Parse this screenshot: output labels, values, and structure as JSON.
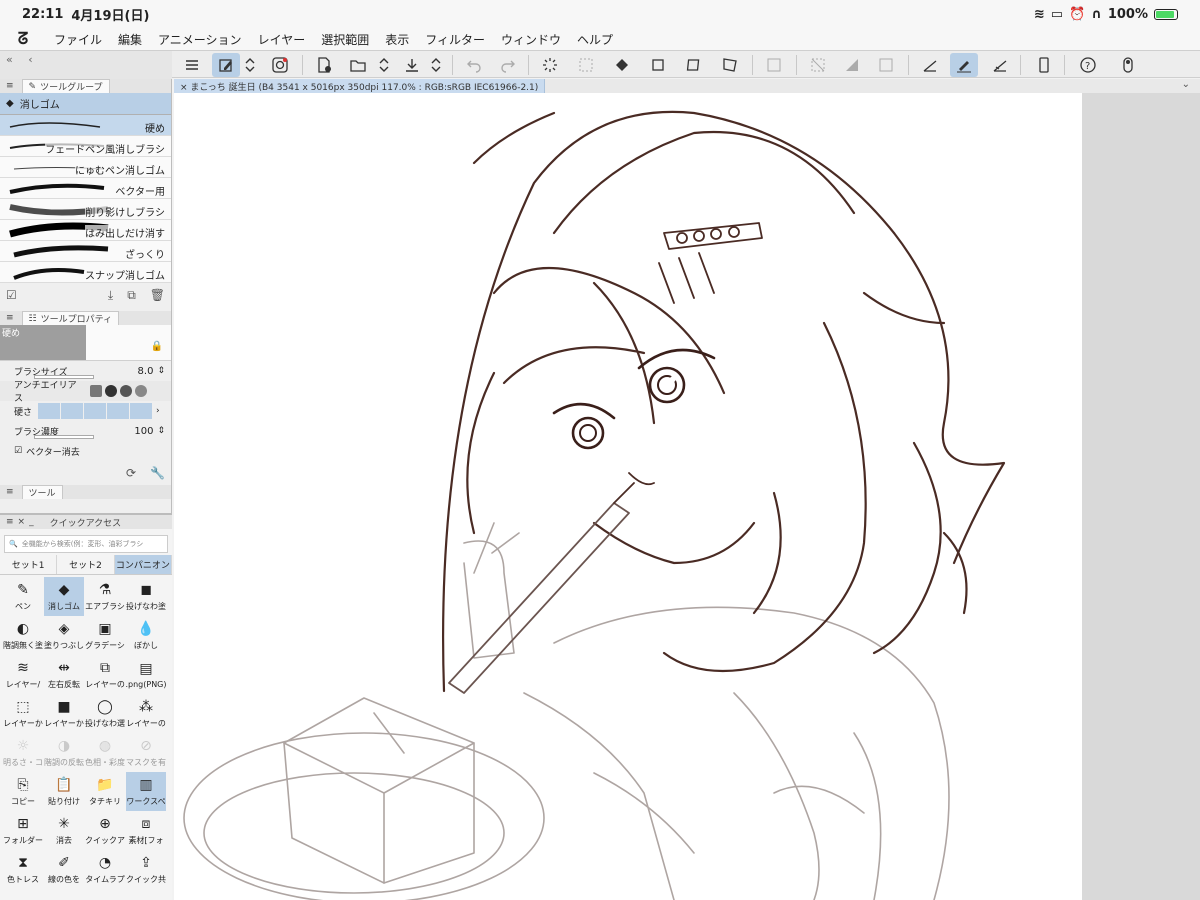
{
  "status": {
    "time": "22:11",
    "date": "4月19日(日)",
    "battery": "100%"
  },
  "menu": [
    "ファイル",
    "編集",
    "アニメーション",
    "レイヤー",
    "選択範囲",
    "表示",
    "フィルター",
    "ウィンドウ",
    "ヘルプ"
  ],
  "document_tab": "まこっち 誕生日 (B4 3541 x 5016px 350dpi 117.0% : RGB:sRGB IEC61966-2.1)",
  "tool_group": {
    "tab": "ツールグループ",
    "current_tool": "消しゴム",
    "brushes": [
      "硬め",
      "フェードペン風消しブラシ",
      "にゅむペン消しゴム",
      "ベクター用",
      "削り影けしブラシ",
      "はみ出しだけ消す",
      "ざっくり",
      "スナップ消しゴム"
    ]
  },
  "tool_property": {
    "tab": "ツールプロパティ",
    "preset": "硬め",
    "brush_size_label": "ブラシサイズ",
    "brush_size": "8.0",
    "antialias_label": "アンチエイリアス",
    "hardness_label": "硬さ",
    "density_label": "ブラシ濃度",
    "density": "100",
    "vector_erase_label": "ベクター消去"
  },
  "tool_tab": "ツール",
  "quick_access": {
    "title": "クイックアクセス",
    "search_placeholder": "全機能から検索(例：変形、油彩ブラシ",
    "sets": [
      "セット1",
      "セット2",
      "コンパニオン"
    ],
    "items": [
      {
        "label": "ペン",
        "icon": "pen-icon"
      },
      {
        "label": "消しゴム",
        "icon": "eraser-icon"
      },
      {
        "label": "エアブラシ",
        "icon": "airbrush-icon"
      },
      {
        "label": "投げなわ塗",
        "icon": "lasso-fill-icon"
      },
      {
        "label": "階調無く塗",
        "icon": "fill-icon"
      },
      {
        "label": "塗りつぶし",
        "icon": "bucket-icon"
      },
      {
        "label": "グラデーシ",
        "icon": "gradient-icon"
      },
      {
        "label": "ぼかし",
        "icon": "blur-icon"
      },
      {
        "label": "レイヤー/",
        "icon": "layers-icon"
      },
      {
        "label": "左右反転",
        "icon": "flip-icon"
      },
      {
        "label": "レイヤーの",
        "icon": "layer-copy-icon"
      },
      {
        "label": ".png(PNG)",
        "icon": "png-icon"
      },
      {
        "label": "レイヤーか",
        "icon": "selection-icon"
      },
      {
        "label": "レイヤーか",
        "icon": "layer-gray-icon"
      },
      {
        "label": "投げなわ選",
        "icon": "lasso-icon"
      },
      {
        "label": "レイヤーの",
        "icon": "layer-dots-icon"
      },
      {
        "label": "明るさ・コ",
        "icon": "brightness-icon"
      },
      {
        "label": "階調の反転",
        "icon": "invert-icon"
      },
      {
        "label": "色相・彩度",
        "icon": "hue-icon"
      },
      {
        "label": "マスクを有",
        "icon": "mask-icon"
      },
      {
        "label": "コピー",
        "icon": "copy-icon"
      },
      {
        "label": "貼り付け",
        "icon": "paste-icon"
      },
      {
        "label": "タチキリ",
        "icon": "folder-icon"
      },
      {
        "label": "ワークスペ",
        "icon": "workspace-icon"
      },
      {
        "label": "フォルダー",
        "icon": "folder-layer-icon"
      },
      {
        "label": "消去",
        "icon": "clear-icon"
      },
      {
        "label": "クイックア",
        "icon": "quick-icon"
      },
      {
        "label": "素材[フォ",
        "icon": "material-icon"
      },
      {
        "label": "色トレス",
        "icon": "trace-icon"
      },
      {
        "label": "線の色を",
        "icon": "line-color-icon"
      },
      {
        "label": "タイムラプ",
        "icon": "timelapse-icon"
      },
      {
        "label": "クイック共",
        "icon": "share-icon"
      }
    ]
  }
}
